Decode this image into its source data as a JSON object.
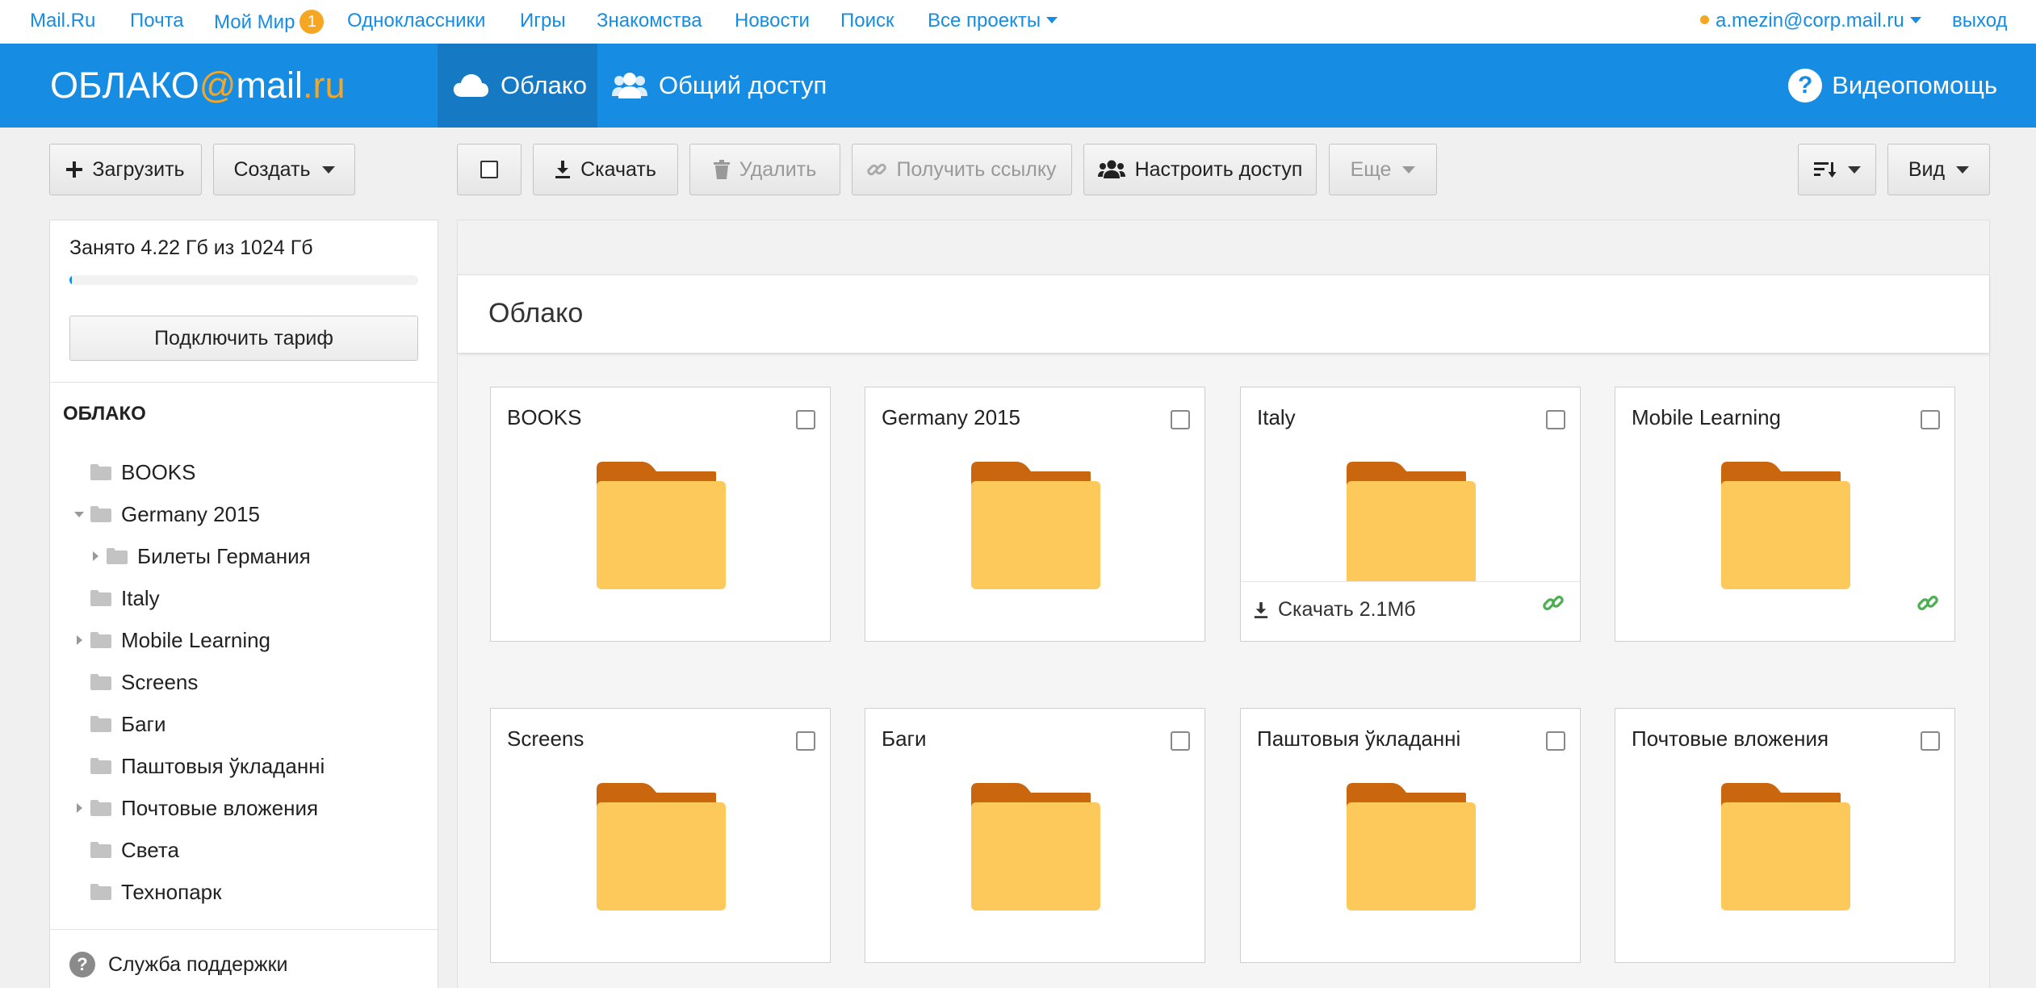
{
  "portal": {
    "links": [
      "Mail.Ru",
      "Почта",
      "Мой Мир",
      "Одноклассники",
      "Игры",
      "Знакомства",
      "Новости",
      "Поиск",
      "Все проекты"
    ],
    "moi_mir_badge": "1",
    "user_email": "a.mezin@corp.mail.ru",
    "logout": "выход"
  },
  "header": {
    "logo": {
      "part1": "ОБЛАКО",
      "at": "@",
      "part2": "mail",
      "dot": ".",
      "part3": "ru"
    },
    "tab_cloud": "Облако",
    "tab_shared": "Общий доступ",
    "help": "Видеопомощь",
    "help_icon": "?"
  },
  "toolbar": {
    "upload": "Загрузить",
    "create": "Создать",
    "download": "Скачать",
    "delete": "Удалить",
    "get_link": "Получить ссылку",
    "configure_access": "Настроить доступ",
    "more": "Еще",
    "view": "Вид"
  },
  "sidebar": {
    "quota_text": "Занято 4.22 Гб из 1024 Гб",
    "quota_used_fraction": 0.004,
    "tariff_button": "Подключить тариф",
    "tree_title": "ОБЛАКО",
    "tree": [
      {
        "label": "BOOKS",
        "level": 0,
        "arrow": "none"
      },
      {
        "label": "Germany 2015",
        "level": 0,
        "arrow": "expanded"
      },
      {
        "label": "Билеты Германия",
        "level": 1,
        "arrow": "collapsed"
      },
      {
        "label": "Italy",
        "level": 0,
        "arrow": "none"
      },
      {
        "label": "Mobile Learning",
        "level": 0,
        "arrow": "collapsed"
      },
      {
        "label": "Screens",
        "level": 0,
        "arrow": "none"
      },
      {
        "label": "Баги",
        "level": 0,
        "arrow": "none"
      },
      {
        "label": "Паштовыя ўкладанні",
        "level": 0,
        "arrow": "none"
      },
      {
        "label": "Почтовые вложения",
        "level": 0,
        "arrow": "collapsed"
      },
      {
        "label": "Света",
        "level": 0,
        "arrow": "none"
      },
      {
        "label": "Технопарк",
        "level": 0,
        "arrow": "none"
      }
    ],
    "support": "Служба поддержки",
    "support_icon": "?"
  },
  "main": {
    "title": "Облако",
    "folders": [
      {
        "name": "BOOKS",
        "shared_link": false,
        "hover": false
      },
      {
        "name": "Germany 2015",
        "shared_link": false,
        "hover": false
      },
      {
        "name": "Italy",
        "shared_link": true,
        "hover": true,
        "download_label": "Скачать 2.1Мб"
      },
      {
        "name": "Mobile Learning",
        "shared_link": true,
        "hover": false
      },
      {
        "name": "Screens",
        "shared_link": false,
        "hover": false
      },
      {
        "name": "Баги",
        "shared_link": false,
        "hover": false
      },
      {
        "name": "Паштовыя ўкладанні",
        "shared_link": false,
        "hover": false
      },
      {
        "name": "Почтовые вложения",
        "shared_link": false,
        "hover": false
      }
    ]
  },
  "colors": {
    "brand_blue": "#168de2",
    "brand_orange": "#f5a623",
    "folder_back": "#c9660e",
    "folder_front": "#fdc95a",
    "link_green": "#4caf50"
  }
}
